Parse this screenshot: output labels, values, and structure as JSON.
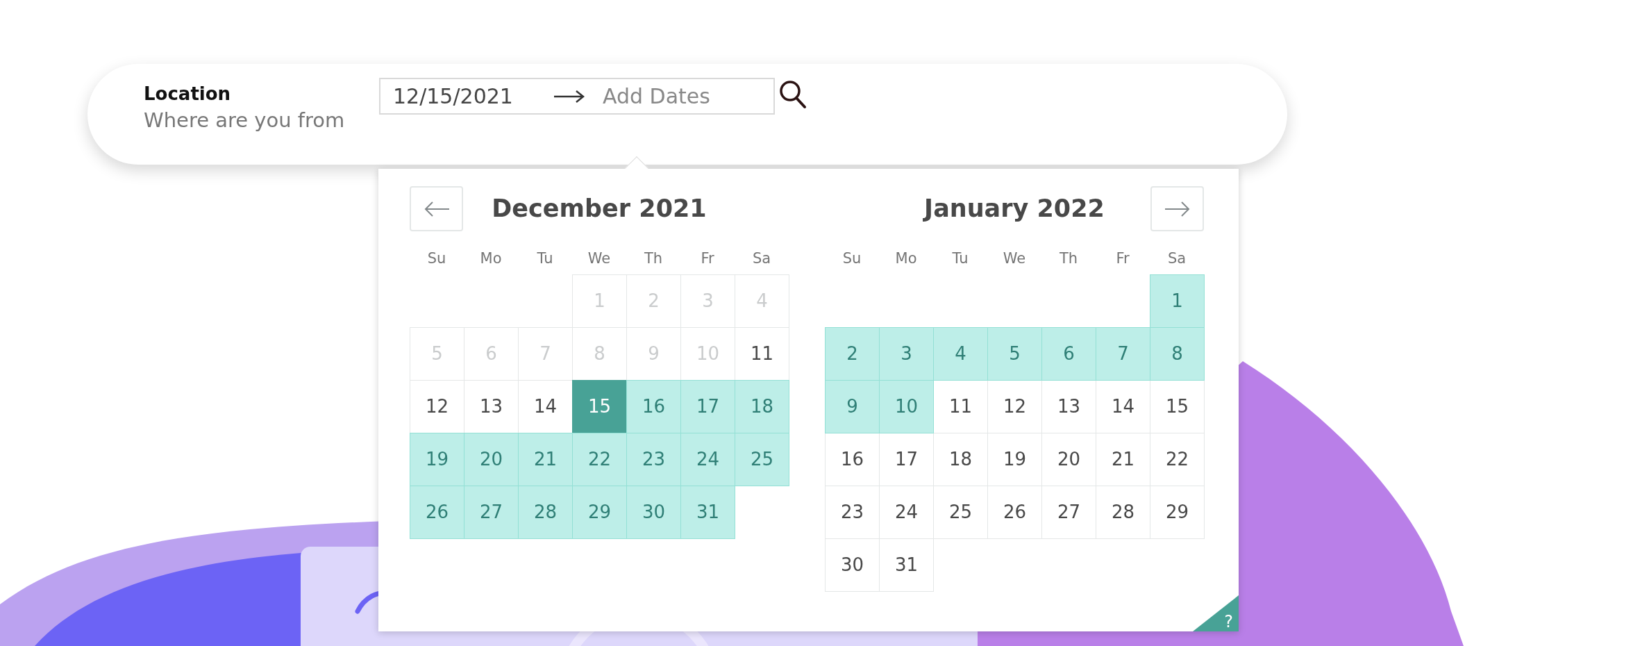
{
  "search_bar": {
    "location_label": "Location",
    "location_hint": "Where are you from",
    "start_date": "12/15/2021",
    "end_date_placeholder": "Add Dates"
  },
  "calendar": {
    "help_label": "?",
    "months": [
      {
        "title": "December 2021",
        "weekdays": [
          "Su",
          "Mo",
          "Tu",
          "We",
          "Th",
          "Fr",
          "Sa"
        ],
        "days": [
          {
            "kind": "empty"
          },
          {
            "kind": "empty"
          },
          {
            "kind": "empty"
          },
          {
            "kind": "day",
            "label": "1",
            "disabled": true,
            "selected": false,
            "in_range": false
          },
          {
            "kind": "day",
            "label": "2",
            "disabled": true,
            "selected": false,
            "in_range": false
          },
          {
            "kind": "day",
            "label": "3",
            "disabled": true,
            "selected": false,
            "in_range": false
          },
          {
            "kind": "day",
            "label": "4",
            "disabled": true,
            "selected": false,
            "in_range": false
          },
          {
            "kind": "day",
            "label": "5",
            "disabled": true,
            "selected": false,
            "in_range": false
          },
          {
            "kind": "day",
            "label": "6",
            "disabled": true,
            "selected": false,
            "in_range": false
          },
          {
            "kind": "day",
            "label": "7",
            "disabled": true,
            "selected": false,
            "in_range": false
          },
          {
            "kind": "day",
            "label": "8",
            "disabled": true,
            "selected": false,
            "in_range": false
          },
          {
            "kind": "day",
            "label": "9",
            "disabled": true,
            "selected": false,
            "in_range": false
          },
          {
            "kind": "day",
            "label": "10",
            "disabled": true,
            "selected": false,
            "in_range": false
          },
          {
            "kind": "day",
            "label": "11",
            "disabled": false,
            "selected": false,
            "in_range": false
          },
          {
            "kind": "day",
            "label": "12",
            "disabled": false,
            "selected": false,
            "in_range": false
          },
          {
            "kind": "day",
            "label": "13",
            "disabled": false,
            "selected": false,
            "in_range": false
          },
          {
            "kind": "day",
            "label": "14",
            "disabled": false,
            "selected": false,
            "in_range": false
          },
          {
            "kind": "day",
            "label": "15",
            "disabled": false,
            "selected": true,
            "in_range": false
          },
          {
            "kind": "day",
            "label": "16",
            "disabled": false,
            "selected": false,
            "in_range": true
          },
          {
            "kind": "day",
            "label": "17",
            "disabled": false,
            "selected": false,
            "in_range": true
          },
          {
            "kind": "day",
            "label": "18",
            "disabled": false,
            "selected": false,
            "in_range": true
          },
          {
            "kind": "day",
            "label": "19",
            "disabled": false,
            "selected": false,
            "in_range": true
          },
          {
            "kind": "day",
            "label": "20",
            "disabled": false,
            "selected": false,
            "in_range": true
          },
          {
            "kind": "day",
            "label": "21",
            "disabled": false,
            "selected": false,
            "in_range": true
          },
          {
            "kind": "day",
            "label": "22",
            "disabled": false,
            "selected": false,
            "in_range": true
          },
          {
            "kind": "day",
            "label": "23",
            "disabled": false,
            "selected": false,
            "in_range": true
          },
          {
            "kind": "day",
            "label": "24",
            "disabled": false,
            "selected": false,
            "in_range": true
          },
          {
            "kind": "day",
            "label": "25",
            "disabled": false,
            "selected": false,
            "in_range": true
          },
          {
            "kind": "day",
            "label": "26",
            "disabled": false,
            "selected": false,
            "in_range": true
          },
          {
            "kind": "day",
            "label": "27",
            "disabled": false,
            "selected": false,
            "in_range": true
          },
          {
            "kind": "day",
            "label": "28",
            "disabled": false,
            "selected": false,
            "in_range": true
          },
          {
            "kind": "day",
            "label": "29",
            "disabled": false,
            "selected": false,
            "in_range": true
          },
          {
            "kind": "day",
            "label": "30",
            "disabled": false,
            "selected": false,
            "in_range": true
          },
          {
            "kind": "day",
            "label": "31",
            "disabled": false,
            "selected": false,
            "in_range": true
          }
        ]
      },
      {
        "title": "January 2022",
        "weekdays": [
          "Su",
          "Mo",
          "Tu",
          "We",
          "Th",
          "Fr",
          "Sa"
        ],
        "days": [
          {
            "kind": "empty"
          },
          {
            "kind": "empty"
          },
          {
            "kind": "empty"
          },
          {
            "kind": "empty"
          },
          {
            "kind": "empty"
          },
          {
            "kind": "empty"
          },
          {
            "kind": "day",
            "label": "1",
            "disabled": false,
            "selected": false,
            "in_range": true
          },
          {
            "kind": "day",
            "label": "2",
            "disabled": false,
            "selected": false,
            "in_range": true
          },
          {
            "kind": "day",
            "label": "3",
            "disabled": false,
            "selected": false,
            "in_range": true
          },
          {
            "kind": "day",
            "label": "4",
            "disabled": false,
            "selected": false,
            "in_range": true
          },
          {
            "kind": "day",
            "label": "5",
            "disabled": false,
            "selected": false,
            "in_range": true
          },
          {
            "kind": "day",
            "label": "6",
            "disabled": false,
            "selected": false,
            "in_range": true
          },
          {
            "kind": "day",
            "label": "7",
            "disabled": false,
            "selected": false,
            "in_range": true
          },
          {
            "kind": "day",
            "label": "8",
            "disabled": false,
            "selected": false,
            "in_range": true
          },
          {
            "kind": "day",
            "label": "9",
            "disabled": false,
            "selected": false,
            "in_range": true
          },
          {
            "kind": "day",
            "label": "10",
            "disabled": false,
            "selected": false,
            "in_range": true
          },
          {
            "kind": "day",
            "label": "11",
            "disabled": false,
            "selected": false,
            "in_range": false
          },
          {
            "kind": "day",
            "label": "12",
            "disabled": false,
            "selected": false,
            "in_range": false
          },
          {
            "kind": "day",
            "label": "13",
            "disabled": false,
            "selected": false,
            "in_range": false
          },
          {
            "kind": "day",
            "label": "14",
            "disabled": false,
            "selected": false,
            "in_range": false
          },
          {
            "kind": "day",
            "label": "15",
            "disabled": false,
            "selected": false,
            "in_range": false
          },
          {
            "kind": "day",
            "label": "16",
            "disabled": false,
            "selected": false,
            "in_range": false
          },
          {
            "kind": "day",
            "label": "17",
            "disabled": false,
            "selected": false,
            "in_range": false
          },
          {
            "kind": "day",
            "label": "18",
            "disabled": false,
            "selected": false,
            "in_range": false
          },
          {
            "kind": "day",
            "label": "19",
            "disabled": false,
            "selected": false,
            "in_range": false
          },
          {
            "kind": "day",
            "label": "20",
            "disabled": false,
            "selected": false,
            "in_range": false
          },
          {
            "kind": "day",
            "label": "21",
            "disabled": false,
            "selected": false,
            "in_range": false
          },
          {
            "kind": "day",
            "label": "22",
            "disabled": false,
            "selected": false,
            "in_range": false
          },
          {
            "kind": "day",
            "label": "23",
            "disabled": false,
            "selected": false,
            "in_range": false
          },
          {
            "kind": "day",
            "label": "24",
            "disabled": false,
            "selected": false,
            "in_range": false
          },
          {
            "kind": "day",
            "label": "25",
            "disabled": false,
            "selected": false,
            "in_range": false
          },
          {
            "kind": "day",
            "label": "26",
            "disabled": false,
            "selected": false,
            "in_range": false
          },
          {
            "kind": "day",
            "label": "27",
            "disabled": false,
            "selected": false,
            "in_range": false
          },
          {
            "kind": "day",
            "label": "28",
            "disabled": false,
            "selected": false,
            "in_range": false
          },
          {
            "kind": "day",
            "label": "29",
            "disabled": false,
            "selected": false,
            "in_range": false
          },
          {
            "kind": "day",
            "label": "30",
            "disabled": false,
            "selected": false,
            "in_range": false
          },
          {
            "kind": "day",
            "label": "31",
            "disabled": false,
            "selected": false,
            "in_range": false
          }
        ]
      }
    ]
  }
}
